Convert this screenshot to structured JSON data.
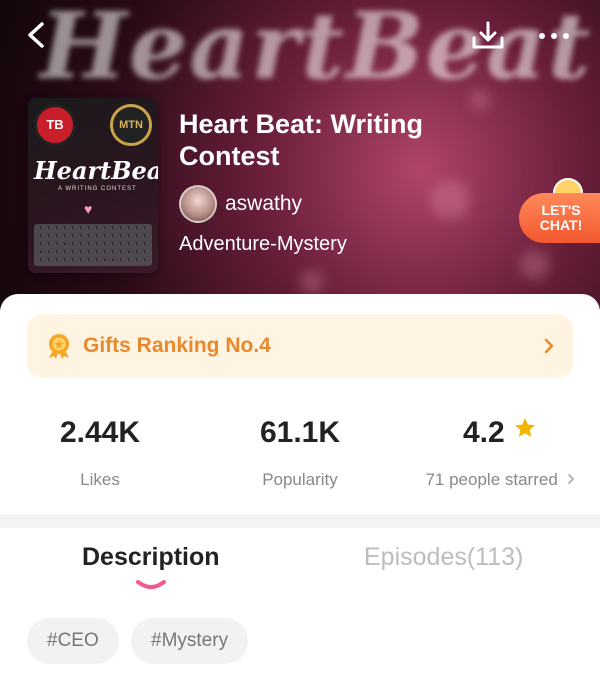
{
  "header": {
    "background_title": "HeartBeat",
    "icons": [
      "back-icon",
      "download-icon",
      "more-icon"
    ]
  },
  "book": {
    "cover_title": "HeartBeat",
    "cover_subtitle": "A WRITING CONTEST",
    "cover_logo_left": "TB",
    "cover_logo_right": "MTN",
    "title": "Heart Beat: Writing Contest",
    "author": "aswathy",
    "genre": "Adventure-Mystery"
  },
  "chat_badge": {
    "label_line1": "LET'S",
    "label_line2": "CHAT!"
  },
  "gifts": {
    "label": "Gifts Ranking No.4"
  },
  "stats": [
    {
      "value": "2.44K",
      "label": "Likes"
    },
    {
      "value": "61.1K",
      "label": "Popularity"
    },
    {
      "value": "4.2",
      "label": "71 people starred"
    }
  ],
  "tabs": {
    "description": "Description",
    "episodes": "Episodes(113)"
  },
  "tags": [
    "#CEO",
    "#Mystery"
  ],
  "colors": {
    "accent": "#e9892b",
    "tab_indicator": "#f05a8c",
    "star": "#f5b400",
    "chat_badge": "#f2582f"
  }
}
